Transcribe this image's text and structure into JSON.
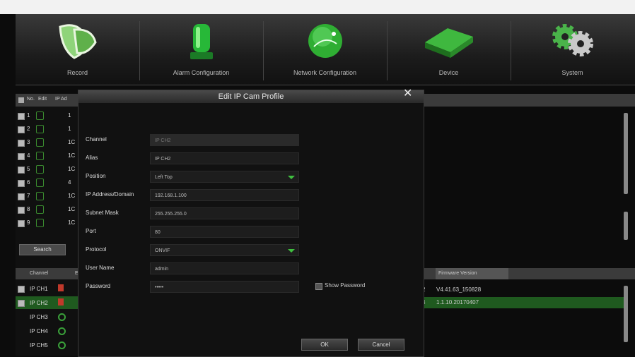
{
  "menu": {
    "items": [
      {
        "label": "Record",
        "icon": "record-icon"
      },
      {
        "label": "Alarm Configuration",
        "icon": "alarm-icon"
      },
      {
        "label": "Network Configuration",
        "icon": "network-icon"
      },
      {
        "label": "Device",
        "icon": "device-icon"
      },
      {
        "label": "System",
        "icon": "system-gear-icon"
      }
    ]
  },
  "bg_table": {
    "headers": [
      "No.",
      "Edit",
      "IP Ad"
    ],
    "rows": [
      {
        "no": "1",
        "val": "1"
      },
      {
        "no": "2",
        "val": "1"
      },
      {
        "no": "3",
        "val": "1C"
      },
      {
        "no": "4",
        "val": "1C"
      },
      {
        "no": "5",
        "val": "1C"
      },
      {
        "no": "6",
        "val": "4"
      },
      {
        "no": "7",
        "val": "1C"
      },
      {
        "no": "8",
        "val": "1C"
      },
      {
        "no": "9",
        "val": "1C"
      }
    ],
    "search_label": "Search",
    "lower_header": "Channel",
    "lower_header_b": "E",
    "firmware_header": "Firmware Version",
    "channels": [
      {
        "name": "IP CH1",
        "status": "delete"
      },
      {
        "name": "IP CH2",
        "status": "delete"
      },
      {
        "name": "IP CH3",
        "status": "online"
      },
      {
        "name": "IP CH4",
        "status": "online"
      },
      {
        "name": "IP CH5",
        "status": "online"
      }
    ],
    "firmware_rows": [
      {
        "prefix": "2",
        "version": "V4.41.63_150828"
      },
      {
        "prefix": "4",
        "version": "1.1.10.20170407"
      }
    ]
  },
  "dialog": {
    "title": "Edit IP Cam Profile",
    "close": "✕",
    "fields": [
      {
        "label": "Channel",
        "value": "IP CH2",
        "disabled": true
      },
      {
        "label": "Alias",
        "value": "IP CH2"
      },
      {
        "label": "Position",
        "value": "Left Top",
        "select": true
      },
      {
        "label": "IP Address/Domain",
        "value": "192.168.1.100"
      },
      {
        "label": "Subnet Mask",
        "value": "255.255.255.0"
      },
      {
        "label": "Port",
        "value": "80"
      },
      {
        "label": "Protocol",
        "value": "ONVIF",
        "select": true
      },
      {
        "label": "User Name",
        "value": "admin"
      },
      {
        "label": "Password",
        "value": "•••••"
      }
    ],
    "show_password": "Show Password",
    "ok": "OK",
    "cancel": "Cancel"
  },
  "colors": {
    "accent": "#3fbf3f",
    "selected_row": "#1f5a1f"
  }
}
